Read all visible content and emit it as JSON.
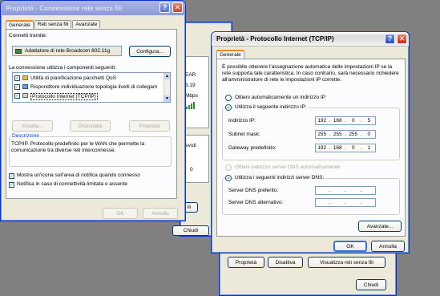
{
  "left_window": {
    "title": "Proprietà - Connessione rete senza fili",
    "tabs": [
      "Generale",
      "Reti senza fili",
      "Avanzate"
    ],
    "connect_using_label": "Connetti tramite:",
    "adapter_name": "Adattatore di rete Broadcom 802.11g",
    "configure_button": "Configura...",
    "components_label": "La connessione utilizza i componenti seguenti:",
    "components": [
      "Utilità di pianificazione pacchetti QoS",
      "Risponditore individuazione topologia livelli di collegam",
      "Protocollo Internet (TCP/IP)"
    ],
    "install_button": "Installa...",
    "uninstall_button": "Disinstalla",
    "properties_button": "Proprietà",
    "description_label": "Descrizione",
    "description_text": "TCP/IP. Protocollo predefinito per le WAN che permette la comunicazione tra diverse reti interconnesse.",
    "show_icon_label": "Mostra un'icona sull'area di notifica quando connesso",
    "notify_label": "Notifica in caso di connettività limitata o assente",
    "ok_button": "OK",
    "cancel_button": "Annulla"
  },
  "background_window": {
    "fragments": [
      "EAR",
      "3.19",
      "Mbps",
      "evuti",
      "0"
    ],
    "partial_button": "ili",
    "close_button": "Chiudi"
  },
  "tcpip_window": {
    "title": "Proprietà - Protocollo Internet (TCP/IP)",
    "tabs": [
      "Generale"
    ],
    "intro_text": "È possibile ottenere l'assegnazione automatica delle impostazioni IP se la rete supporta tale caratteristica. In caso contrario, sarà necessario richiedere all'amministratore di rete le impostazioni IP corrette.",
    "auto_ip_label": "Ottieni automaticamente un indirizzo IP",
    "manual_ip_label": "Utilizza il seguente indirizzo IP:",
    "ip_label": "Indirizzo IP:",
    "ip_value": [
      "192",
      "168",
      "0",
      "5"
    ],
    "mask_label": "Subnet mask:",
    "mask_value": [
      "255",
      "255",
      "255",
      "0"
    ],
    "gateway_label": "Gateway predefinito:",
    "gateway_value": [
      "192",
      "168",
      "0",
      "1"
    ],
    "auto_dns_label": "Ottieni indirizzo server DNS automaticamente",
    "manual_dns_label": "Utilizza i seguenti indirizzi server DNS:",
    "dns_pref_label": "Server DNS preferito:",
    "dns_alt_label": "Server DNS alternativo:",
    "advanced_button": "Avanzate...",
    "ok_button": "OK",
    "cancel_button": "Annulla"
  },
  "bottom_window": {
    "properties_button": "Proprietà",
    "disable_button": "Disattiva",
    "view_networks_button": "Visualizza reti senza fili",
    "close_button": "Chiudi"
  }
}
